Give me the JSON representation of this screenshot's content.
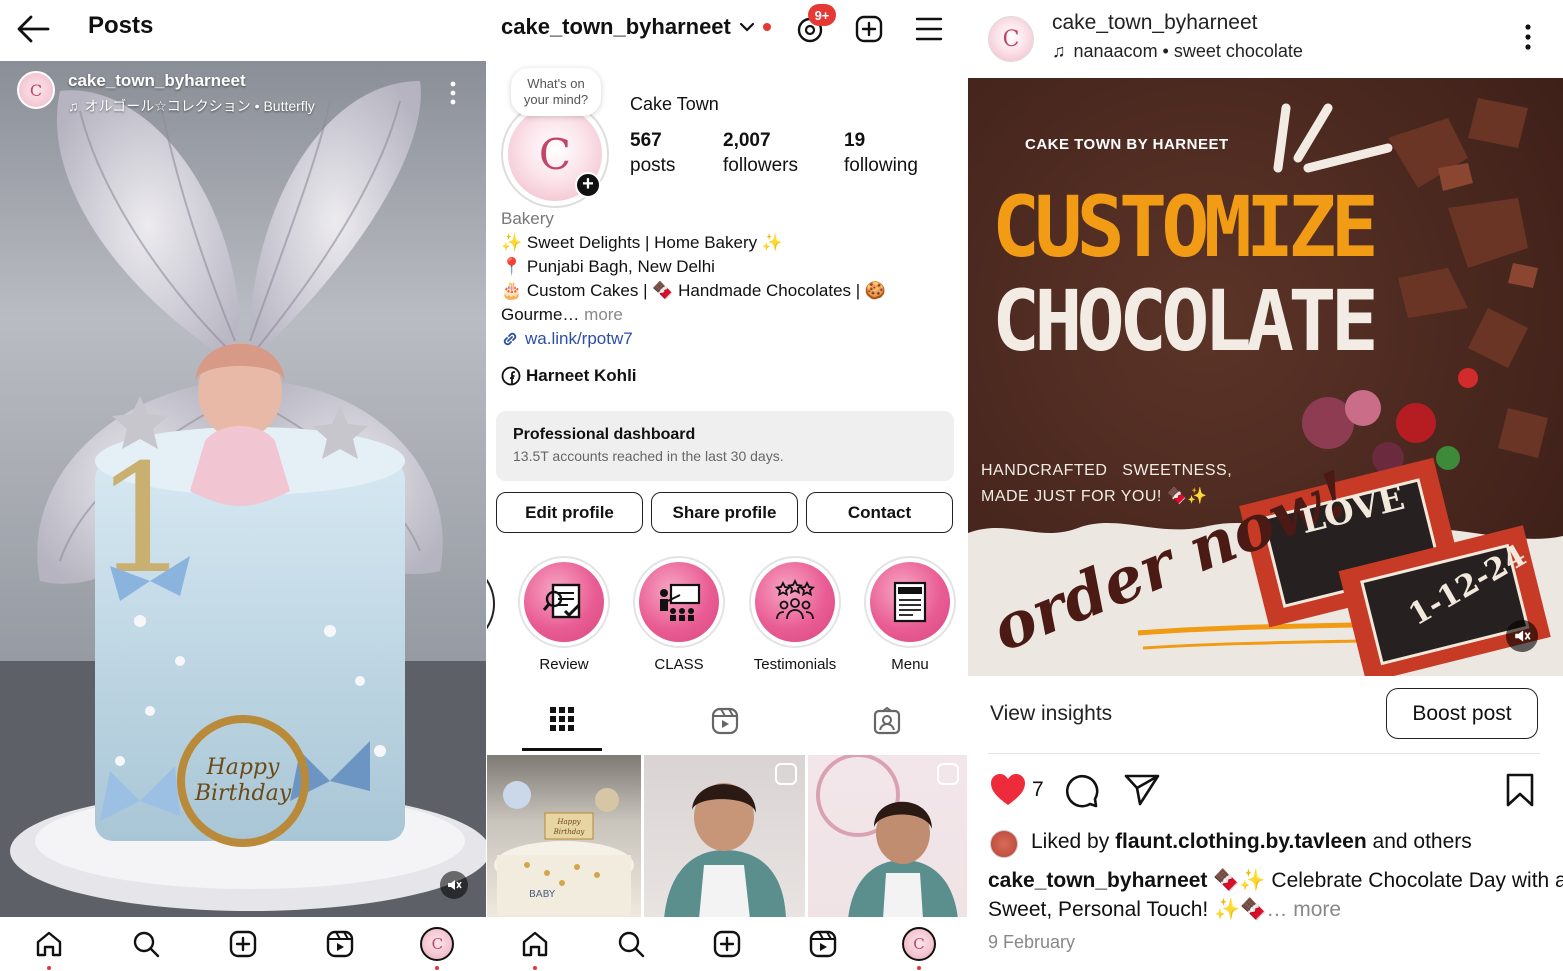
{
  "colors": {
    "accent_red": "#e53935",
    "link": "#2b4ea8",
    "heart": "#ed2b3a",
    "chip_bg": "#efefef"
  },
  "panel1": {
    "header": {
      "back_icon": "arrow-left-icon",
      "title": "Posts"
    },
    "post": {
      "username": "cake_town_byharneet",
      "audio": "オルゴール☆コレクション • Butterfly",
      "cake_topper": "Happy Birthday",
      "number_topper": "1"
    },
    "mute_icon": "muted-speaker-icon"
  },
  "panel2": {
    "header": {
      "username": "cake_town_byharneet",
      "notif_badge": "9+"
    },
    "note_bubble": "What's on your mind?",
    "name": "Cake Town",
    "stats": [
      {
        "value": "567",
        "label": "posts"
      },
      {
        "value": "2,007",
        "label": "followers"
      },
      {
        "value": "19",
        "label": "following"
      }
    ],
    "category": "Bakery",
    "bio": {
      "line1": "✨ Sweet Delights | Home Bakery ✨",
      "line2": "📍 Punjabi Bagh, New Delhi",
      "line3": "🎂 Custom Cakes | 🍫 Handmade Chocolates | 🍪",
      "line4": "Gourme…",
      "more": "more",
      "link": "wa.link/rpotw7",
      "facebook": "Harneet Kohli"
    },
    "dashboard": {
      "title": "Professional dashboard",
      "subtitle": "13.5T accounts reached in the last 30 days."
    },
    "buttons": {
      "edit": "Edit profile",
      "share": "Share profile",
      "contact": "Contact"
    },
    "highlights": [
      {
        "label": "Review"
      },
      {
        "label": "CLASS"
      },
      {
        "label": "Testimonials"
      },
      {
        "label": "Menu"
      }
    ],
    "thumbs": {
      "cake_label": "Happy Birthday",
      "baby_label": "BABY"
    }
  },
  "panel3": {
    "header": {
      "username": "cake_town_byharneet",
      "audio": "nanaacom • sweet chocolate"
    },
    "poster": {
      "brand": "CAKE TOWN BY HARNEET",
      "headline1": "CUSTOMIZE",
      "headline2": "CHOCOLATE",
      "tagline1": "HANDCRAFTED   SWEETNESS,",
      "tagline2": "MADE JUST FOR YOU! 🍫✨",
      "cta": "order now!",
      "bar1": "LOVE",
      "bar2": "1-12-24"
    },
    "insights": "View insights",
    "boost": "Boost post",
    "likes_count": "7",
    "liked_prefix": "Liked by",
    "liked_user": "flaunt.clothing.by.tavleen",
    "liked_suffix": "and others",
    "caption_user": "cake_town_byharneet",
    "caption_line1": "🍫✨ Celebrate Chocolate Day with a",
    "caption_line2": "Sweet, Personal Touch! ✨🍫",
    "caption_more": "… more",
    "date": "9 February"
  }
}
